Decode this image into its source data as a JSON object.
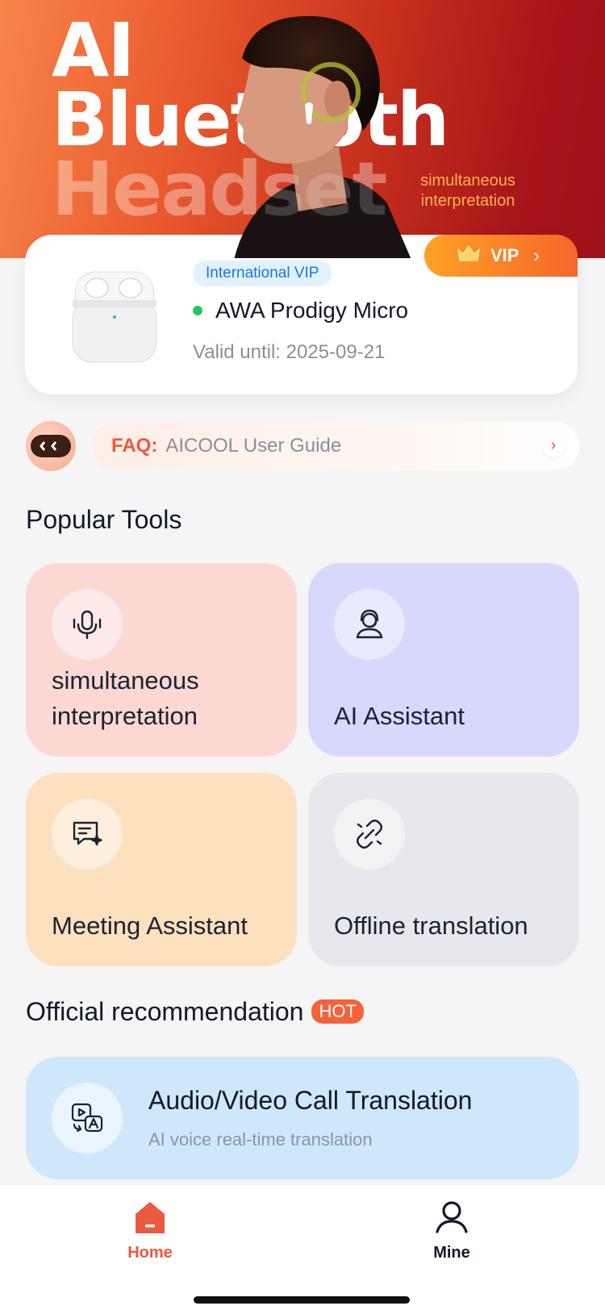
{
  "hero": {
    "title_line1": "AI",
    "title_line2": "Bluetooth",
    "title_line3": "Headset",
    "subtitle_line1": "simultaneous",
    "subtitle_line2": "interpretation"
  },
  "device_card": {
    "vip_label": "VIP",
    "badge": "International VIP",
    "device_name": "AWA Prodigy Micro",
    "status_color": "#22c55e",
    "valid_until": "Valid until: 2025-09-21"
  },
  "faq": {
    "label": "FAQ:",
    "text": "AICOOL User Guide"
  },
  "popular_tools": {
    "title": "Popular Tools",
    "items": [
      {
        "label": "simultaneous interpretation",
        "icon": "microphone-icon",
        "color": "#fcd8d3"
      },
      {
        "label": "AI Assistant",
        "icon": "assistant-headset-icon",
        "color": "#d6d9fc"
      },
      {
        "label": "Meeting Assistant",
        "icon": "chat-sparkle-icon",
        "color": "#fde0bd"
      },
      {
        "label": "Offline translation",
        "icon": "link-broken-icon",
        "color": "#e7e8ed"
      }
    ]
  },
  "recommendation": {
    "title": "Official recommendation",
    "hot": "HOT",
    "card_title": "Audio/Video Call Translation",
    "card_subtitle": "AI voice real-time translation"
  },
  "tabbar": {
    "home": "Home",
    "mine": "Mine",
    "active_color": "#ea5a3c"
  }
}
